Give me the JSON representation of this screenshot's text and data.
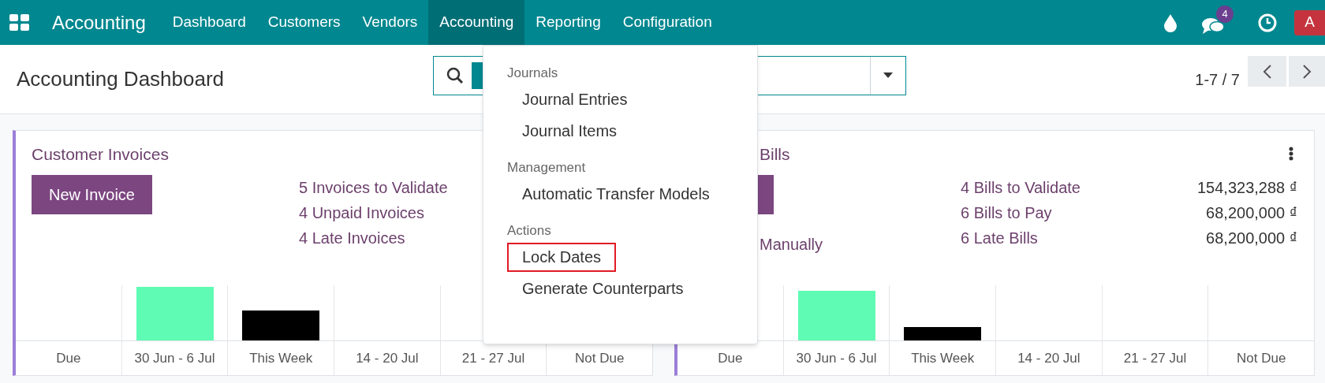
{
  "app": {
    "title": "Accounting"
  },
  "nav": [
    {
      "label": "Dashboard",
      "selected": false
    },
    {
      "label": "Customers",
      "selected": false
    },
    {
      "label": "Vendors",
      "selected": false
    },
    {
      "label": "Accounting",
      "selected": true
    },
    {
      "label": "Reporting",
      "selected": false
    },
    {
      "label": "Configuration",
      "selected": false
    }
  ],
  "notifications": {
    "count": "4"
  },
  "avatar": {
    "initial": "A"
  },
  "page": {
    "title": "Accounting Dashboard"
  },
  "pager": {
    "text": "1-7 / 7"
  },
  "cards": [
    {
      "title": "Customer Invoices",
      "button": "New Invoice",
      "links": [
        {
          "label": "5 Invoices to Validate"
        },
        {
          "label": "4 Unpaid Invoices"
        },
        {
          "label": "4 Late Invoices"
        }
      ],
      "categories": [
        "Due",
        "30 Jun - 6 Jul",
        "This Week",
        "14 - 20 Jul",
        "21 - 27 Jul",
        "Not Due"
      ]
    },
    {
      "title": "Bills",
      "extra_link": "Manually",
      "links": [
        {
          "label": "4 Bills to Validate",
          "amount": "154,323,288 ₫"
        },
        {
          "label": "6 Bills to Pay",
          "amount": "68,200,000 ₫"
        },
        {
          "label": "6 Late Bills",
          "amount": "68,200,000 ₫"
        }
      ],
      "categories": [
        "Due",
        "30 Jun - 6 Jul",
        "This Week",
        "14 - 20 Jul",
        "21 - 27 Jul",
        "Not Due"
      ]
    }
  ],
  "menu": {
    "sections": [
      {
        "heading": "Journals",
        "items": [
          {
            "label": "Journal Entries",
            "highlighted": false
          },
          {
            "label": "Journal Items",
            "highlighted": false
          }
        ]
      },
      {
        "heading": "Management",
        "items": [
          {
            "label": "Automatic Transfer Models",
            "highlighted": false
          }
        ]
      },
      {
        "heading": "Actions",
        "items": [
          {
            "label": "Lock Dates",
            "highlighted": true
          },
          {
            "label": "Generate Counterparts",
            "highlighted": false
          }
        ]
      }
    ]
  }
}
